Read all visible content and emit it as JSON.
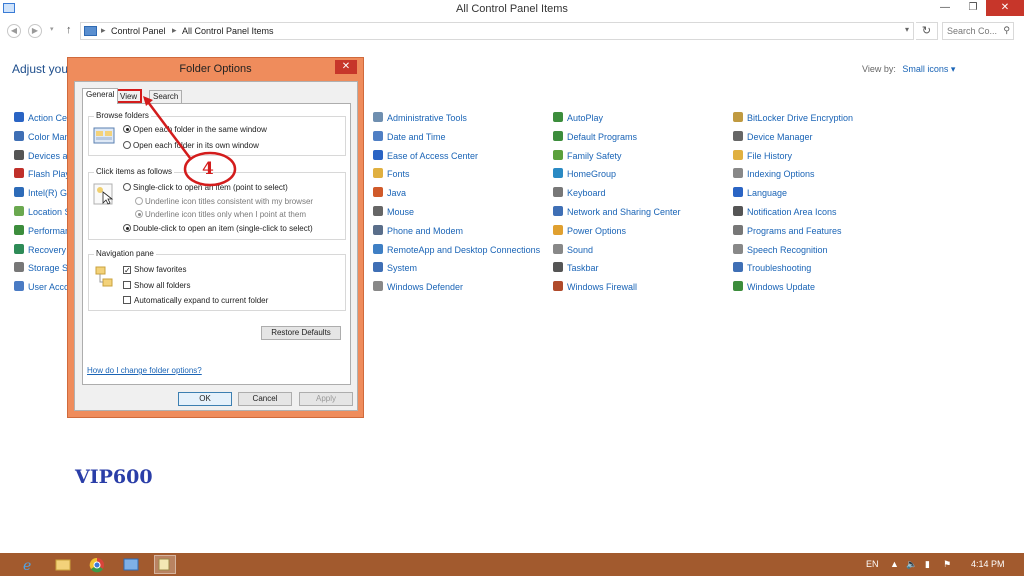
{
  "window": {
    "title": "All Control Panel Items",
    "minimize": "—",
    "maximize": "❐",
    "close": "✕"
  },
  "addressbar": {
    "crumbs": [
      "Control Panel",
      "All Control Panel Items"
    ],
    "search_placeholder": "Search Co..."
  },
  "main": {
    "heading": "Adjust you",
    "view_by_label": "View by:",
    "view_by_value": "Small icons ▾",
    "col1": [
      {
        "label": "Action Ce",
        "color": "#2a64c4"
      },
      {
        "label": "Color Man",
        "color": "#3f6fb5"
      },
      {
        "label": "Devices an",
        "color": "#555555"
      },
      {
        "label": "Flash Play",
        "color": "#c0302a"
      },
      {
        "label": "Intel(R) Gr",
        "color": "#2d6bb8"
      },
      {
        "label": "Location S",
        "color": "#6aa84f"
      },
      {
        "label": "Performan",
        "color": "#3c8d3c"
      },
      {
        "label": "Recovery",
        "color": "#2e8b57"
      },
      {
        "label": "Storage Sp",
        "color": "#777777"
      },
      {
        "label": "User Acco",
        "color": "#4a7bc4"
      }
    ],
    "col2": [
      {
        "label": "Administrative Tools",
        "color": "#6f8fb0"
      },
      {
        "label": "Date and Time",
        "color": "#4f7fc4"
      },
      {
        "label": "Ease of Access Center",
        "color": "#2a64c4"
      },
      {
        "label": "Fonts",
        "color": "#e0b040"
      },
      {
        "label": "Java",
        "color": "#d05a2a"
      },
      {
        "label": "Mouse",
        "color": "#666666"
      },
      {
        "label": "Phone and Modem",
        "color": "#5a6e8a"
      },
      {
        "label": "RemoteApp and Desktop Connections",
        "color": "#3f7fc4"
      },
      {
        "label": "System",
        "color": "#3f6fb5"
      },
      {
        "label": "Windows Defender",
        "color": "#888888"
      }
    ],
    "col3": [
      {
        "label": "AutoPlay",
        "color": "#3c8d3c"
      },
      {
        "label": "Default Programs",
        "color": "#3c8d3c"
      },
      {
        "label": "Family Safety",
        "color": "#5aa03c"
      },
      {
        "label": "HomeGroup",
        "color": "#2a8ac4"
      },
      {
        "label": "Keyboard",
        "color": "#777777"
      },
      {
        "label": "Network and Sharing Center",
        "color": "#3f6fb5"
      },
      {
        "label": "Power Options",
        "color": "#e0a030"
      },
      {
        "label": "Sound",
        "color": "#888888"
      },
      {
        "label": "Taskbar",
        "color": "#555555"
      },
      {
        "label": "Windows Firewall",
        "color": "#b04a2a"
      }
    ],
    "col4": [
      {
        "label": "BitLocker Drive Encryption",
        "color": "#c09a40"
      },
      {
        "label": "Device Manager",
        "color": "#666666"
      },
      {
        "label": "File History",
        "color": "#e0b040"
      },
      {
        "label": "Indexing Options",
        "color": "#888888"
      },
      {
        "label": "Language",
        "color": "#2a64c4"
      },
      {
        "label": "Notification Area Icons",
        "color": "#555555"
      },
      {
        "label": "Programs and Features",
        "color": "#777777"
      },
      {
        "label": "Speech Recognition",
        "color": "#888888"
      },
      {
        "label": "Troubleshooting",
        "color": "#3f6fb5"
      },
      {
        "label": "Windows Update",
        "color": "#3c8d3c"
      }
    ]
  },
  "dialog": {
    "title": "Folder Options",
    "close": "✕",
    "tabs": [
      "General",
      "View",
      "Search"
    ],
    "browse_title": "Browse folders",
    "browse_opt1": "Open each folder in the same window",
    "browse_opt2": "Open each folder in its own window",
    "click_title": "Click items as follows",
    "click_opt1": "Single-click to open an item (point to select)",
    "click_sub1": "Underline icon titles consistent with my browser",
    "click_sub2": "Underline icon titles only when I point at them",
    "click_opt2": "Double-click to open an item (single-click to select)",
    "nav_title": "Navigation pane",
    "nav_opt1": "Show favorites",
    "nav_opt2": "Show all folders",
    "nav_opt3": "Automatically expand to current folder",
    "restore": "Restore Defaults",
    "help_link": "How do I change folder options?",
    "ok": "OK",
    "cancel": "Cancel",
    "apply": "Apply"
  },
  "annotation": {
    "number": "4",
    "color": "#d31c1c"
  },
  "watermark": "VIP600",
  "taskbar": {
    "lang": "EN",
    "time": "4:14 PM",
    "color": "#a25a2e"
  }
}
